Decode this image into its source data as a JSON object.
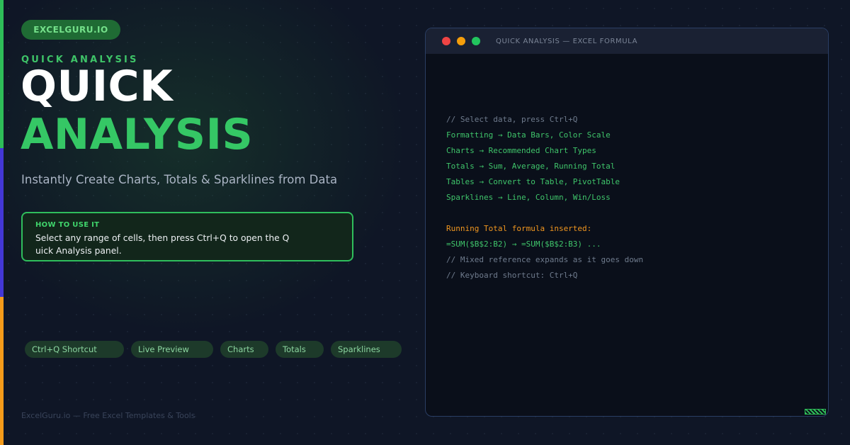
{
  "brand": {
    "badge": "EXCELGURU.IO"
  },
  "hero": {
    "kicker": "QUICK ANALYSIS",
    "title_line1": "QUICK",
    "title_line2": "ANALYSIS",
    "subtitle": "Instantly Create Charts, Totals & Sparklines from Data"
  },
  "how_to": {
    "label": "HOW TO USE IT",
    "text": "Select any range of cells, then press Ctrl+Q to open the Quick Analysis panel."
  },
  "tags": [
    "Ctrl+Q Shortcut",
    "Live Preview",
    "Charts",
    "Totals",
    "Sparklines"
  ],
  "footer": {
    "text": "ExcelGuru.io — Free Excel Templates & Tools"
  },
  "window": {
    "title": "QUICK ANALYSIS — EXCEL FORMULA",
    "lines": [
      "// Select data, press Ctrl+Q",
      "Formatting → Data Bars, Color Scale",
      "Charts → Recommended Chart Types",
      "Totals → Sum, Average, Running Total",
      "Tables → Convert to Table, PivotTable",
      "Sparklines → Line, Column, Win/Loss",
      "",
      "Running Total formula inserted:",
      "=SUM($B$2:B2) → =SUM($B$2:B3) ...",
      "// Mixed reference expands as it goes down",
      "// Keyboard shortcut: Ctrl+Q"
    ]
  },
  "colors": {
    "accent_green": "#2ebd58",
    "accent_blue": "#4337d6",
    "accent_orange": "#f59b1a",
    "background": "#0f1626"
  }
}
